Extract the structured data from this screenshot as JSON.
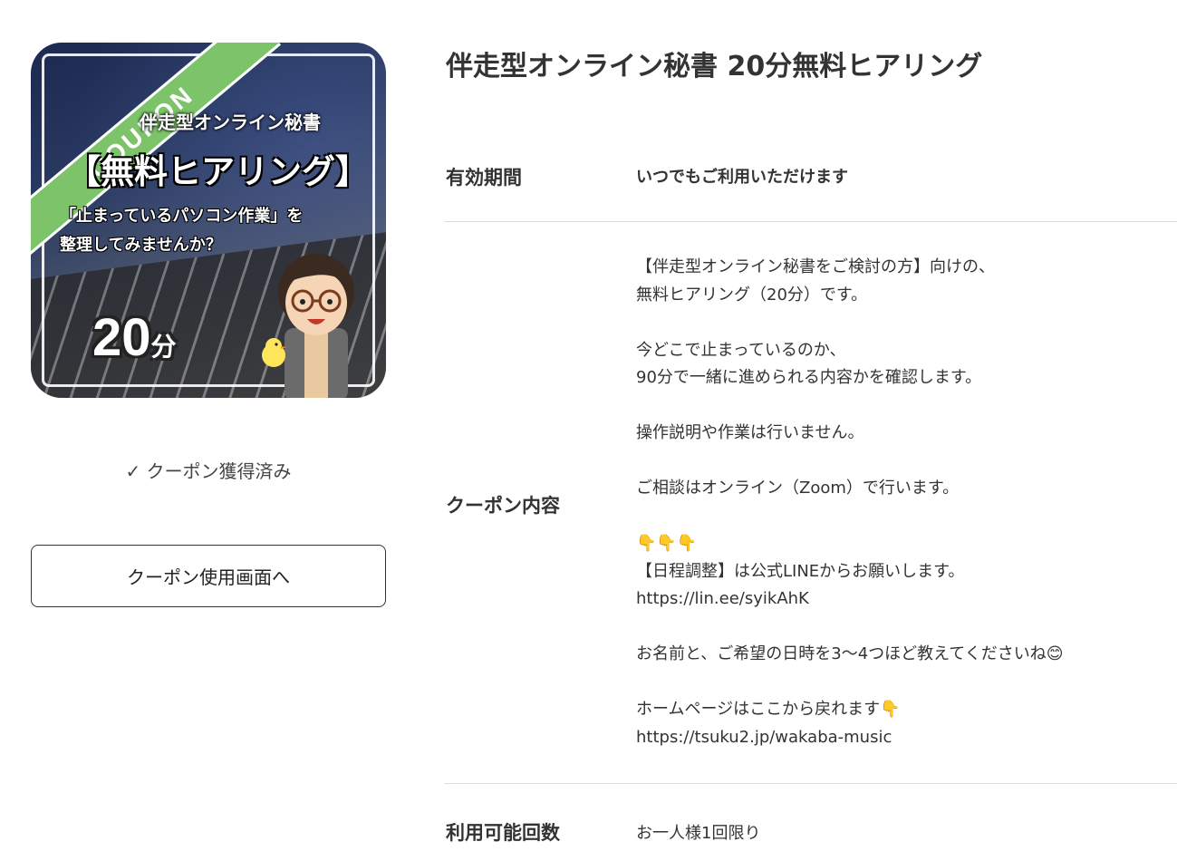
{
  "coupon_image": {
    "ribbon": "COUPON",
    "line1": "伴走型オンライン秘書",
    "line2": "【無料ヒアリング】",
    "line3a": "「止まっているパソコン作業」を",
    "line3b": "整理してみませんか？",
    "minutes": "20",
    "minutes_unit": "分"
  },
  "obtained_label": "✓ クーポン獲得済み",
  "use_button_label": "クーポン使用画面へ",
  "title": "伴走型オンライン秘書 20分無料ヒアリング",
  "validity": {
    "label": "有効期間",
    "value": "いつでもご利用いただけます"
  },
  "content": {
    "label": "クーポン内容",
    "p1a": "【伴走型オンライン秘書をご検討の方】向けの、",
    "p1b": "無料ヒアリング（20分）です。",
    "p2a": "今どこで止まっているのか、",
    "p2b": "90分で一緒に進められる内容かを確認します。",
    "p3": "操作説明や作業は行いません。",
    "p4": "ご相談はオンライン（Zoom）で行います。",
    "hands": "👇👇👇",
    "p5a": "【日程調整】は公式LINEからお願いします。",
    "p5b": "https://lin.ee/syikAhK",
    "p6": "お名前と、ご希望の日時を3〜4つほど教えてくださいね",
    "p6_emoji": "😊",
    "p7": "ホームページはここから戻れます",
    "p7_emoji": "👇",
    "p7b": "https://tsuku2.jp/wakaba-music"
  },
  "usage": {
    "label": "利用可能回数",
    "value": "お一人様1回限り"
  },
  "colors": {
    "ribbon": "#7cc36a",
    "text": "#333333",
    "divider": "#dddddd"
  }
}
